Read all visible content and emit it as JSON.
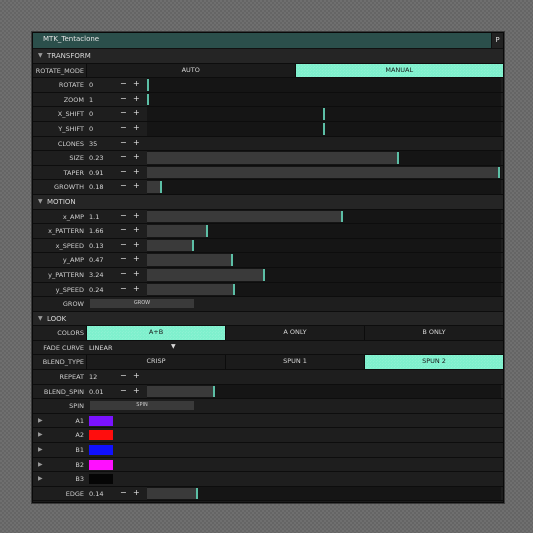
{
  "window": {
    "title": "MTK_Tentaclone",
    "corner_button": "P"
  },
  "colors": {
    "accent": "#7ef0cd",
    "marker": "#5cbfa6",
    "titlebar": "#2b4f4b"
  },
  "sections": {
    "transform": "TRANSFORM",
    "motion": "MOTION",
    "look": "LOOK"
  },
  "transform": {
    "rotate_mode": {
      "label": "ROTATE_MODE",
      "options": [
        "AUTO",
        "MANUAL"
      ],
      "selected": "MANUAL"
    },
    "rotate": {
      "label": "ROTATE",
      "value": "0",
      "fraction": 0.0
    },
    "zoom": {
      "label": "ZOOM",
      "value": "1",
      "fraction": 0.0
    },
    "x_shift": {
      "label": "X_SHIFT",
      "value": "0",
      "fraction": 0.5
    },
    "y_shift": {
      "label": "Y_SHIFT",
      "value": "0",
      "fraction": 0.5
    },
    "clones": {
      "label": "CLONES",
      "value": "35"
    },
    "size": {
      "label": "SIZE",
      "value": "0.23",
      "fraction": 0.71
    },
    "taper": {
      "label": "TAPER",
      "value": "0.91",
      "fraction": 0.995
    },
    "growth": {
      "label": "GROWTH",
      "value": "0.18",
      "fraction": 0.04
    }
  },
  "motion": {
    "x_amp": {
      "label": "x_AMP",
      "value": "1.1",
      "fraction": 0.55
    },
    "x_pattern": {
      "label": "x_PATTERN",
      "value": "1.66",
      "fraction": 0.17
    },
    "x_speed": {
      "label": "x_SPEED",
      "value": "0.13",
      "fraction": 0.13
    },
    "y_amp": {
      "label": "y_AMP",
      "value": "0.47",
      "fraction": 0.24
    },
    "y_pattern": {
      "label": "y_PATTERN",
      "value": "3.24",
      "fraction": 0.33
    },
    "y_speed": {
      "label": "y_SPEED",
      "value": "0.24",
      "fraction": 0.245
    },
    "grow": {
      "label": "GROW",
      "button": "GROW"
    }
  },
  "look": {
    "colors": {
      "label": "COLORS",
      "options": [
        "A+B",
        "A ONLY",
        "B ONLY"
      ],
      "selected": "A+B"
    },
    "fade_curve": {
      "label": "FADE CURVE",
      "value": "LINEAR"
    },
    "blend_type": {
      "label": "BLEND_TYPE",
      "options": [
        "CRISP",
        "SPUN 1",
        "SPUN 2"
      ],
      "selected": "SPUN 2"
    },
    "repeat": {
      "label": "REPEAT",
      "value": "12"
    },
    "blend_spin": {
      "label": "BLEND_SPIN",
      "value": "0.01",
      "fraction": 0.19
    },
    "spin": {
      "label": "SPIN",
      "button": "SPIN"
    },
    "swatches": [
      {
        "label": "A1",
        "color": "#7a12ff"
      },
      {
        "label": "A2",
        "color": "#ff0d0d"
      },
      {
        "label": "B1",
        "color": "#1010ff"
      },
      {
        "label": "B2",
        "color": "#ff10ff"
      },
      {
        "label": "B3",
        "color": "#050505"
      }
    ],
    "edge": {
      "label": "EDGE",
      "value": "0.14",
      "fraction": 0.14
    }
  },
  "stepper": {
    "minus": "−",
    "plus": "+"
  },
  "icons": {
    "expand": "triangle-down-icon",
    "collapsed": "triangle-right-icon"
  }
}
